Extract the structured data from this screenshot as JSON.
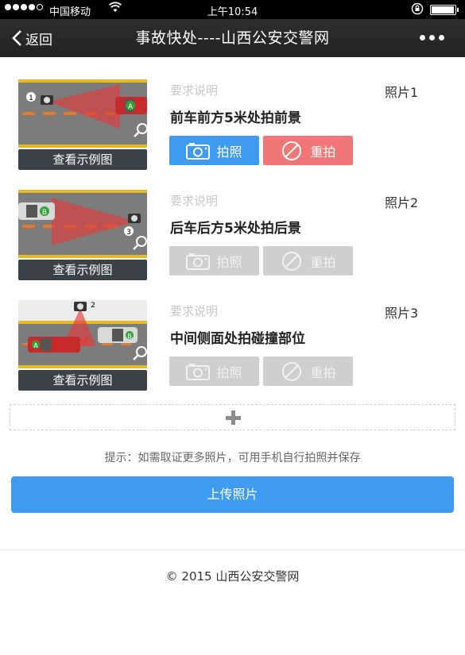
{
  "status": {
    "carrier": "中国移动",
    "time": "上午10:54"
  },
  "nav": {
    "back_label": "返回",
    "title": "事故快处----山西公安交警网"
  },
  "items": [
    {
      "requirement_label": "要求说明",
      "photo_number": "照片1",
      "description": "前车前方5米处拍前景",
      "example_label": "查看示例图",
      "camera_label": "拍照",
      "retake_label": "重拍",
      "marker_a": "A",
      "camera_mark": "1",
      "enabled": true
    },
    {
      "requirement_label": "要求说明",
      "photo_number": "照片2",
      "description": "后车后方5米处拍后景",
      "example_label": "查看示例图",
      "camera_label": "拍照",
      "retake_label": "重拍",
      "marker_b": "B",
      "camera_mark": "3",
      "enabled": false
    },
    {
      "requirement_label": "要求说明",
      "photo_number": "照片3",
      "description": "中间侧面处拍碰撞部位",
      "example_label": "查看示例图",
      "camera_label": "拍照",
      "retake_label": "重拍",
      "marker_a": "A",
      "marker_b": "B",
      "camera_mark": "2",
      "enabled": false
    }
  ],
  "hint": "提示：如需取证更多照片，可用手机自行拍照并保存",
  "upload_label": "上传照片",
  "footer": "© 2015 山西公安交警网",
  "colors": {
    "primary": "#3f9bf0",
    "danger": "#f07677",
    "disabled": "#cfcfcf",
    "navbar": "#262626"
  }
}
